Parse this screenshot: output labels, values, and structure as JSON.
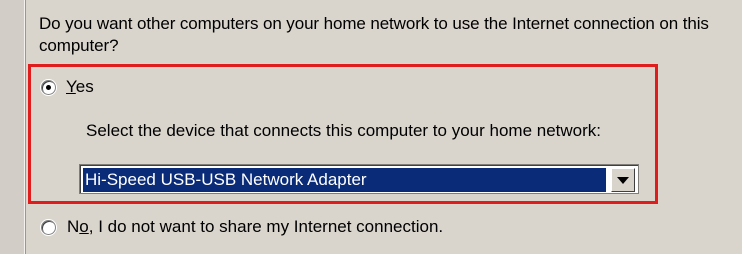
{
  "dialog": {
    "question": "Do you want other computers on your home network to use the Internet connection on this computer?",
    "yes_option": {
      "label_prefix": "",
      "mnemonic": "Y",
      "label_suffix": "es",
      "selected": true
    },
    "instruction": "Select the device that connects this computer to your home network:",
    "device_select": {
      "selected_value": "Hi-Speed USB-USB Network Adapter"
    },
    "no_option": {
      "label_prefix": "N",
      "mnemonic": "o",
      "label_suffix": ", I do not want to share my Internet connection.",
      "selected": false
    }
  },
  "colors": {
    "background": "#d9d5cd",
    "highlight_border": "#e01d1d",
    "selection_background": "#0a2b78"
  },
  "icons": {
    "dropdown": "chevron-down-icon"
  }
}
